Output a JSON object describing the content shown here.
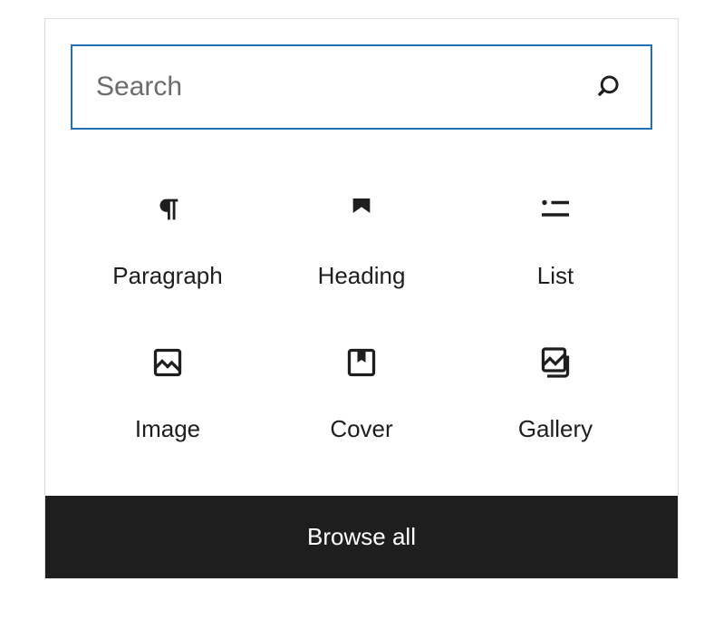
{
  "search": {
    "placeholder": "Search",
    "value": ""
  },
  "blocks": [
    {
      "icon": "paragraph-icon",
      "label": "Paragraph"
    },
    {
      "icon": "heading-icon",
      "label": "Heading"
    },
    {
      "icon": "list-icon",
      "label": "List"
    },
    {
      "icon": "image-icon",
      "label": "Image"
    },
    {
      "icon": "cover-icon",
      "label": "Cover"
    },
    {
      "icon": "gallery-icon",
      "label": "Gallery"
    }
  ],
  "footer": {
    "browse_all_label": "Browse all"
  }
}
